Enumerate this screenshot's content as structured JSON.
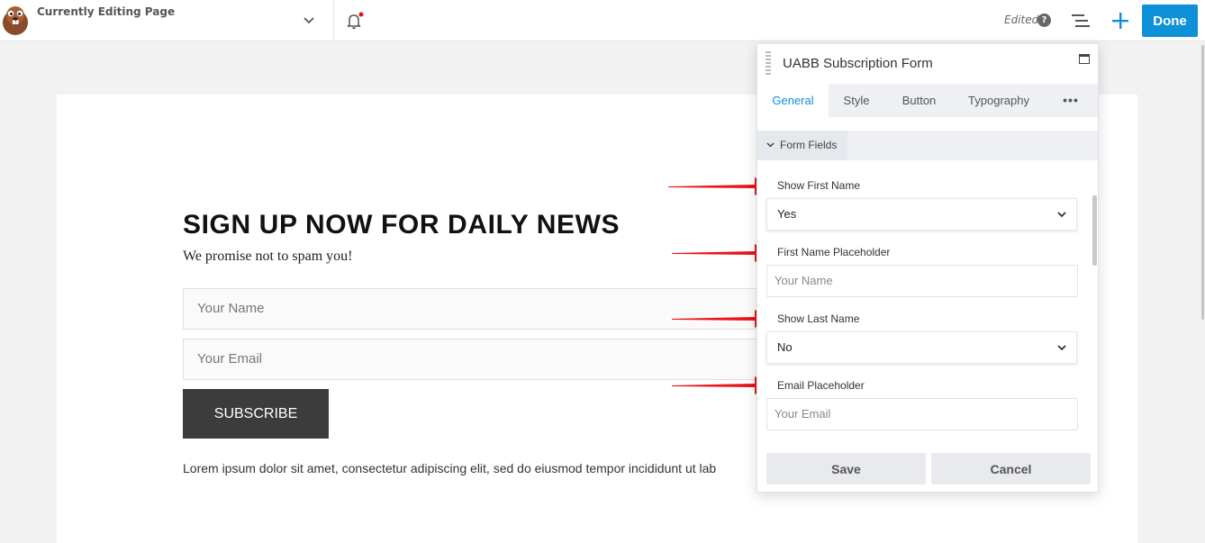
{
  "topbar": {
    "editing_label": "Currently Editing Page",
    "edited_status": "Edited",
    "help_symbol": "?",
    "done_label": "Done",
    "icons": [
      "beaver-logo-icon",
      "chevron-down-icon",
      "bell-icon",
      "help-icon",
      "outline-list-icon",
      "plus-icon"
    ],
    "notification_dot_color": "#e0101a",
    "accent_color": "#0e91d6"
  },
  "page": {
    "headline": "SIGN UP NOW FOR DAILY NEWS",
    "subline": "We promise not to spam you!",
    "name_placeholder": "Your Name",
    "email_placeholder": "Your Email",
    "subscribe_label": "SUBSCRIBE",
    "body_text": "Lorem ipsum dolor sit amet, consectetur adipiscing elit, sed do eiusmod tempor incididunt ut lab"
  },
  "panel": {
    "title": "UABB Subscription Form",
    "tabs": [
      {
        "label": "General",
        "active": true
      },
      {
        "label": "Style",
        "active": false
      },
      {
        "label": "Button",
        "active": false
      },
      {
        "label": "Typography",
        "active": false
      },
      {
        "label": "•••",
        "active": false
      }
    ],
    "section": "Form Fields",
    "fields": [
      {
        "label": "Show First Name",
        "type": "select",
        "value": "Yes"
      },
      {
        "label": "First Name Placeholder",
        "type": "text",
        "value": "Your Name"
      },
      {
        "label": "Show Last Name",
        "type": "select",
        "value": "No"
      },
      {
        "label": "Email Placeholder",
        "type": "text",
        "value": "Your Email"
      }
    ],
    "save_label": "Save",
    "cancel_label": "Cancel"
  },
  "annotations": {
    "arrow_color": "#e8141a",
    "arrow_count": 4
  }
}
